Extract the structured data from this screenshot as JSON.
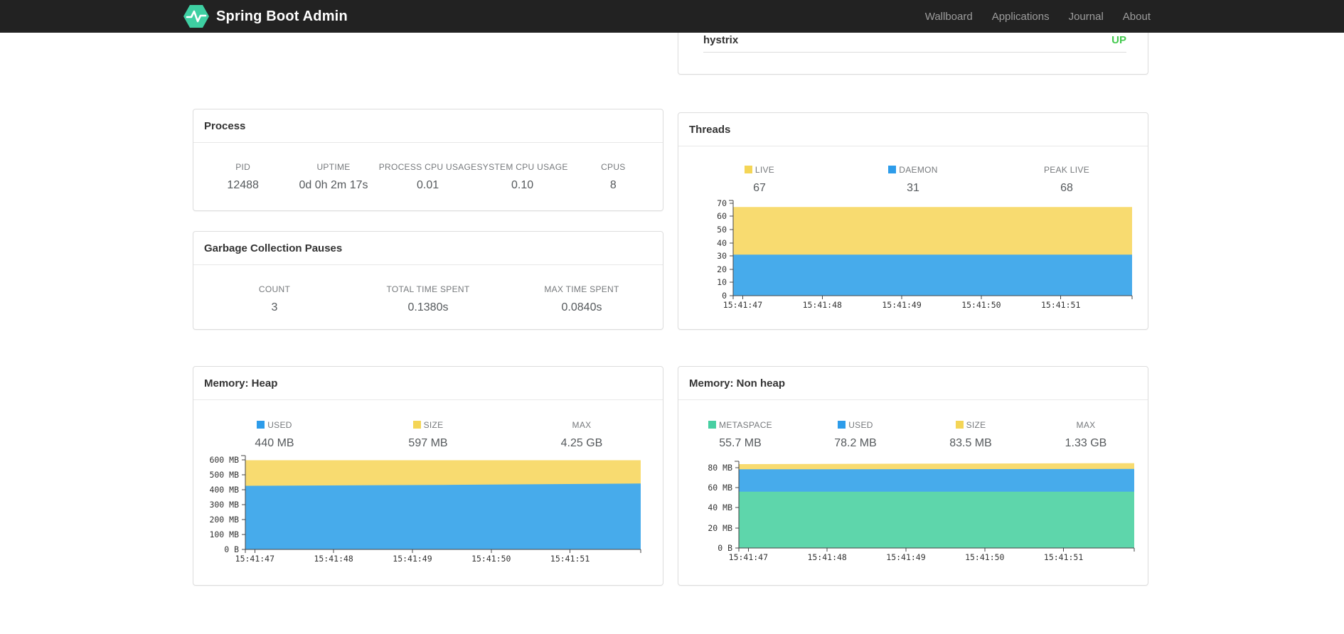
{
  "navbar": {
    "brand": "Spring Boot Admin",
    "brand_color": "#ffffff",
    "bg": "#222222",
    "link_color": "#9d9d9d",
    "logo_color": "#3ecfa2",
    "links": [
      {
        "label": "Wallboard"
      },
      {
        "label": "Applications"
      },
      {
        "label": "Journal"
      },
      {
        "label": "About"
      }
    ]
  },
  "application_panel": {
    "name": "hystrix",
    "status": "UP",
    "status_color": "#42c94d"
  },
  "process": {
    "title": "Process",
    "stats": [
      {
        "label": "PID",
        "value": "12488"
      },
      {
        "label": "UPTIME",
        "value": "0d 0h 2m 17s"
      },
      {
        "label": "PROCESS CPU USAGE",
        "value": "0.01"
      },
      {
        "label": "SYSTEM CPU USAGE",
        "value": "0.10"
      },
      {
        "label": "CPUS",
        "value": "8"
      }
    ]
  },
  "gc": {
    "title": "Garbage Collection Pauses",
    "stats": [
      {
        "label": "COUNT",
        "value": "3"
      },
      {
        "label": "TOTAL TIME SPENT",
        "value": "0.1380s"
      },
      {
        "label": "MAX TIME SPENT",
        "value": "0.0840s"
      }
    ]
  },
  "threads_panel": {
    "title": "Threads",
    "stats": [
      {
        "label": "LIVE",
        "value": "67",
        "swatch": "#f4d556"
      },
      {
        "label": "DAEMON",
        "value": "31",
        "swatch": "#2d9cea"
      },
      {
        "label": "PEAK LIVE",
        "value": "68"
      }
    ]
  },
  "heap_panel": {
    "title": "Memory: Heap",
    "stats": [
      {
        "label": "USED",
        "value": "440 MB",
        "swatch": "#2d9cea"
      },
      {
        "label": "SIZE",
        "value": "597 MB",
        "swatch": "#f4d556"
      },
      {
        "label": "MAX",
        "value": "4.25 GB"
      }
    ]
  },
  "nonheap_panel": {
    "title": "Memory: Non heap",
    "stats": [
      {
        "label": "METASPACE",
        "value": "55.7 MB",
        "swatch": "#47cfa2"
      },
      {
        "label": "USED",
        "value": "78.2 MB",
        "swatch": "#2d9cea"
      },
      {
        "label": "SIZE",
        "value": "83.5 MB",
        "swatch": "#f4d556"
      },
      {
        "label": "MAX",
        "value": "1.33 GB"
      }
    ]
  },
  "charts": {
    "threads": {
      "type": "area",
      "title": "Threads",
      "ymax": 72,
      "legend_position": "top",
      "y_ticks": [
        {
          "v": 0,
          "label": "0"
        },
        {
          "v": 10,
          "label": "10"
        },
        {
          "v": 20,
          "label": "20"
        },
        {
          "v": 30,
          "label": "30"
        },
        {
          "v": 40,
          "label": "40"
        },
        {
          "v": 50,
          "label": "50"
        },
        {
          "v": 60,
          "label": "60"
        },
        {
          "v": 70,
          "label": "70"
        }
      ],
      "x_labels": [
        "15:41:47",
        "15:41:48",
        "15:41:49",
        "15:41:50",
        "15:41:51"
      ],
      "series": [
        {
          "name": "DAEMON",
          "color": "#47abeb",
          "points": [
            {
              "x": 0,
              "v": 31
            },
            {
              "x": 1,
              "v": 31
            }
          ]
        },
        {
          "name": "LIVE",
          "color": "#f8db70",
          "points": [
            {
              "x": 0,
              "v": 67
            },
            {
              "x": 1,
              "v": 67
            }
          ]
        }
      ]
    },
    "heap": {
      "type": "area",
      "title": "Memory: Heap",
      "ymax": 628,
      "legend_position": "top",
      "y_ticks": [
        {
          "v": 0,
          "label": "0 B"
        },
        {
          "v": 100,
          "label": "100 MB"
        },
        {
          "v": 200,
          "label": "200 MB"
        },
        {
          "v": 300,
          "label": "300 MB"
        },
        {
          "v": 400,
          "label": "400 MB"
        },
        {
          "v": 500,
          "label": "500 MB"
        },
        {
          "v": 600,
          "label": "600 MB"
        }
      ],
      "x_labels": [
        "15:41:47",
        "15:41:48",
        "15:41:49",
        "15:41:50",
        "15:41:51"
      ],
      "series": [
        {
          "name": "USED",
          "color": "#47abeb",
          "points": [
            {
              "x": 0,
              "v": 426
            },
            {
              "x": 0.5,
              "v": 432
            },
            {
              "x": 1,
              "v": 441
            }
          ]
        },
        {
          "name": "SIZE",
          "color": "#f8db70",
          "points": [
            {
              "x": 0,
              "v": 597
            },
            {
              "x": 1,
              "v": 597
            }
          ]
        }
      ]
    },
    "nonheap": {
      "type": "area",
      "title": "Memory: Non heap",
      "ymax": 86,
      "legend_position": "top",
      "y_ticks": [
        {
          "v": 0,
          "label": "0 B"
        },
        {
          "v": 20,
          "label": "20 MB"
        },
        {
          "v": 40,
          "label": "40 MB"
        },
        {
          "v": 60,
          "label": "60 MB"
        },
        {
          "v": 80,
          "label": "80 MB"
        }
      ],
      "x_labels": [
        "15:41:47",
        "15:41:48",
        "15:41:49",
        "15:41:50",
        "15:41:51"
      ],
      "series": [
        {
          "name": "METASPACE",
          "color": "#5ed6ab",
          "points": [
            {
              "x": 0,
              "v": 55.9
            },
            {
              "x": 1,
              "v": 55.9
            }
          ]
        },
        {
          "name": "USED",
          "color": "#47abeb",
          "points": [
            {
              "x": 0,
              "v": 78.0
            },
            {
              "x": 1,
              "v": 78.4
            }
          ]
        },
        {
          "name": "SIZE",
          "color": "#f8db70",
          "points": [
            {
              "x": 0,
              "v": 83.2
            },
            {
              "x": 1,
              "v": 84.2
            }
          ]
        }
      ]
    }
  }
}
